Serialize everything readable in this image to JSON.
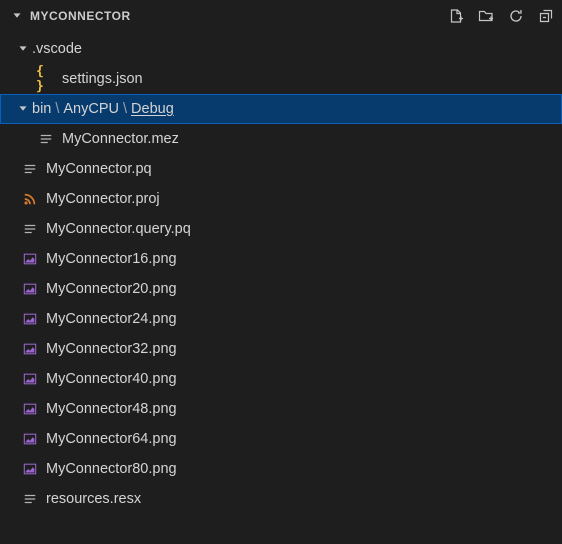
{
  "header": {
    "title": "MYCONNECTOR"
  },
  "tree": {
    "vscode": {
      "label": ".vscode",
      "settings": "settings.json"
    },
    "bin": {
      "crumb1": "bin",
      "crumb2": "AnyCPU",
      "crumb3": "Debug",
      "mez": "MyConnector.mez"
    },
    "root_files": {
      "pq": "MyConnector.pq",
      "proj": "MyConnector.proj",
      "querypq": "MyConnector.query.pq",
      "png16": "MyConnector16.png",
      "png20": "MyConnector20.png",
      "png24": "MyConnector24.png",
      "png32": "MyConnector32.png",
      "png40": "MyConnector40.png",
      "png48": "MyConnector48.png",
      "png64": "MyConnector64.png",
      "png80": "MyConnector80.png",
      "resx": "resources.resx"
    }
  }
}
